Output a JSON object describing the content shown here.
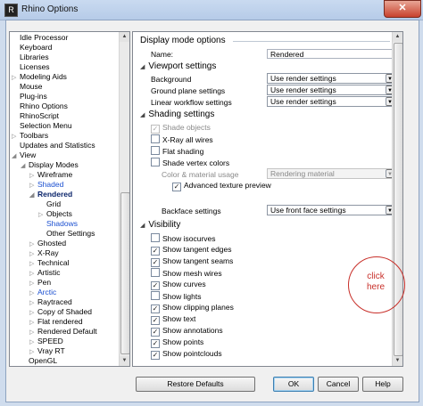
{
  "window": {
    "title": "Rhino Options",
    "close_glyph": "✕"
  },
  "tree": {
    "items": [
      {
        "label": "Idle Processor",
        "indent": 0,
        "arrow": ""
      },
      {
        "label": "Keyboard",
        "indent": 0,
        "arrow": ""
      },
      {
        "label": "Libraries",
        "indent": 0,
        "arrow": ""
      },
      {
        "label": "Licenses",
        "indent": 0,
        "arrow": ""
      },
      {
        "label": "Modeling Aids",
        "indent": 0,
        "arrow": "▷"
      },
      {
        "label": "Mouse",
        "indent": 0,
        "arrow": ""
      },
      {
        "label": "Plug-ins",
        "indent": 0,
        "arrow": ""
      },
      {
        "label": "Rhino Options",
        "indent": 0,
        "arrow": ""
      },
      {
        "label": "RhinoScript",
        "indent": 0,
        "arrow": ""
      },
      {
        "label": "Selection Menu",
        "indent": 0,
        "arrow": ""
      },
      {
        "label": "Toolbars",
        "indent": 0,
        "arrow": "▷"
      },
      {
        "label": "Updates and Statistics",
        "indent": 0,
        "arrow": ""
      },
      {
        "label": "View",
        "indent": 0,
        "arrow": "◢"
      },
      {
        "label": "Display Modes",
        "indent": 1,
        "arrow": "◢"
      },
      {
        "label": "Wireframe",
        "indent": 2,
        "arrow": "▷"
      },
      {
        "label": "Shaded",
        "indent": 2,
        "arrow": "▷",
        "style": "blue"
      },
      {
        "label": "Rendered",
        "indent": 2,
        "arrow": "◢",
        "style": "sel"
      },
      {
        "label": "Grid",
        "indent": 3,
        "arrow": ""
      },
      {
        "label": "Objects",
        "indent": 3,
        "arrow": "▷"
      },
      {
        "label": "Shadows",
        "indent": 3,
        "arrow": "",
        "style": "blue"
      },
      {
        "label": "Other Settings",
        "indent": 3,
        "arrow": ""
      },
      {
        "label": "Ghosted",
        "indent": 2,
        "arrow": "▷"
      },
      {
        "label": "X-Ray",
        "indent": 2,
        "arrow": "▷"
      },
      {
        "label": "Technical",
        "indent": 2,
        "arrow": "▷"
      },
      {
        "label": "Artistic",
        "indent": 2,
        "arrow": "▷"
      },
      {
        "label": "Pen",
        "indent": 2,
        "arrow": "▷"
      },
      {
        "label": "Arctic",
        "indent": 2,
        "arrow": "▷",
        "style": "blue"
      },
      {
        "label": "Raytraced",
        "indent": 2,
        "arrow": "▷"
      },
      {
        "label": "Copy of Shaded",
        "indent": 2,
        "arrow": "▷"
      },
      {
        "label": "Flat rendered",
        "indent": 2,
        "arrow": "▷"
      },
      {
        "label": "Rendered Default",
        "indent": 2,
        "arrow": "▷"
      },
      {
        "label": "SPEED",
        "indent": 2,
        "arrow": "▷"
      },
      {
        "label": "Vray RT",
        "indent": 2,
        "arrow": "▷"
      },
      {
        "label": "OpenGL",
        "indent": 1,
        "arrow": ""
      }
    ]
  },
  "panel": {
    "header": "Display mode options",
    "name_label": "Name:",
    "name_value": "Rendered",
    "viewport": {
      "title": "Viewport settings",
      "rows": [
        {
          "label": "Background",
          "value": "Use render settings"
        },
        {
          "label": "Ground plane settings",
          "value": "Use render settings"
        },
        {
          "label": "Linear workflow settings",
          "value": "Use render settings"
        }
      ]
    },
    "shading": {
      "title": "Shading settings",
      "shade_objects": "Shade objects",
      "xray": "X-Ray all wires",
      "flat": "Flat shading",
      "vertex": "Shade vertex colors",
      "color_usage_label": "Color & material usage",
      "color_usage_value": "Rendering material",
      "advanced_texture": "Advanced texture preview",
      "backface_label": "Backface settings",
      "backface_value": "Use front face settings"
    },
    "visibility": {
      "title": "Visibility",
      "items": [
        {
          "label": "Show isocurves",
          "checked": false
        },
        {
          "label": "Show tangent edges",
          "checked": true
        },
        {
          "label": "Show tangent seams",
          "checked": true
        },
        {
          "label": "Show mesh wires",
          "checked": false
        },
        {
          "label": "Show curves",
          "checked": true
        },
        {
          "label": "Show lights",
          "checked": false
        },
        {
          "label": "Show clipping planes",
          "checked": true
        },
        {
          "label": "Show text",
          "checked": true
        },
        {
          "label": "Show annotations",
          "checked": true
        },
        {
          "label": "Show points",
          "checked": true
        },
        {
          "label": "Show pointclouds",
          "checked": true
        }
      ]
    }
  },
  "annotation": {
    "text_line1": "click",
    "text_line2": "here",
    "color": "#c8302a"
  },
  "buttons": {
    "restore": "Restore Defaults",
    "ok": "OK",
    "cancel": "Cancel",
    "help": "Help"
  }
}
